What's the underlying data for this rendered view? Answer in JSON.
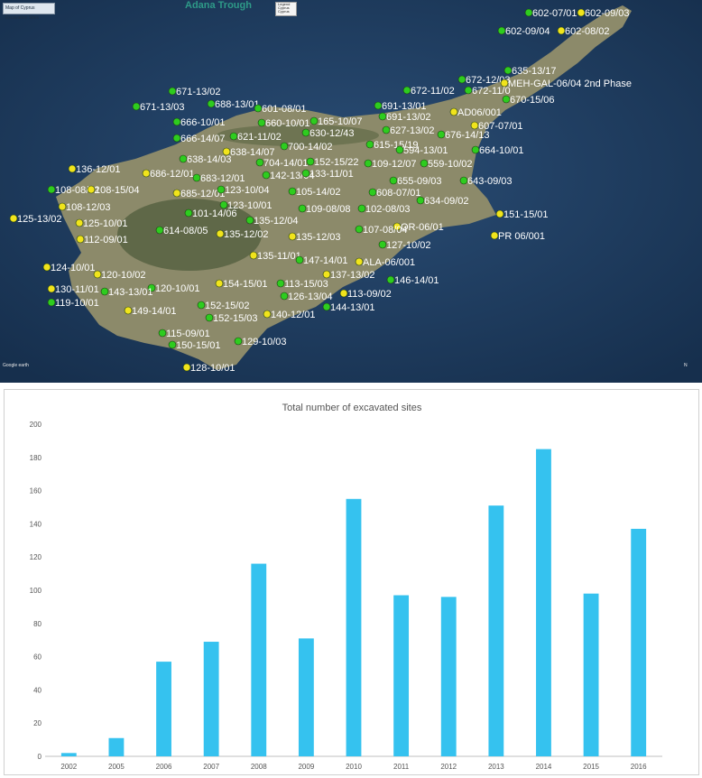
{
  "map": {
    "title_box": "Map of Cyprus Excavation Sites",
    "trough_label": "Adana Trough",
    "legend_title": "Legend",
    "legend_items": [
      "Cyprus",
      "Cyprus"
    ],
    "credit": "Google earth",
    "scale_note": "N",
    "colors": {
      "sea": "#1f3d63",
      "land": "#8c8a6a",
      "forest": "#5f6848",
      "pin_green": "#2ecc1f",
      "pin_yellow": "#f1e41c",
      "label": "#ffffff"
    },
    "sites": [
      {
        "label": "602-07/01",
        "pin": "green"
      },
      {
        "label": "602-09/03",
        "pin": "yellow"
      },
      {
        "label": "602-09/04",
        "pin": "green"
      },
      {
        "label": "602-08/02",
        "pin": "yellow"
      },
      {
        "label": "635-13/17",
        "pin": "green"
      },
      {
        "label": "672-12/03",
        "pin": "green"
      },
      {
        "label": "MEH-GAL-06/04 2nd Phase",
        "pin": "yellow"
      },
      {
        "label": "672-11/02",
        "pin": "green"
      },
      {
        "label": "672-11/0",
        "pin": "green"
      },
      {
        "label": "670-15/06",
        "pin": "green"
      },
      {
        "label": "671-13/02",
        "pin": "green"
      },
      {
        "label": "688-13/01",
        "pin": "green"
      },
      {
        "label": "671-13/03",
        "pin": "green"
      },
      {
        "label": "601-08/01",
        "pin": "green"
      },
      {
        "label": "691-13/01",
        "pin": "green"
      },
      {
        "label": "AD06/001",
        "pin": "yellow"
      },
      {
        "label": "607-07/01",
        "pin": "yellow"
      },
      {
        "label": "666-10/01",
        "pin": "green"
      },
      {
        "label": "660-10/01",
        "pin": "green"
      },
      {
        "label": "165-10/07",
        "pin": "green"
      },
      {
        "label": "691-13/02",
        "pin": "green"
      },
      {
        "label": "666-14/07",
        "pin": "green"
      },
      {
        "label": "621-11/02",
        "pin": "green"
      },
      {
        "label": "630-12/43",
        "pin": "green"
      },
      {
        "label": "627-13/02",
        "pin": "green"
      },
      {
        "label": "676-14/13",
        "pin": "green"
      },
      {
        "label": "700-14/02",
        "pin": "green"
      },
      {
        "label": "615-15/19",
        "pin": "green"
      },
      {
        "label": "594-13/01",
        "pin": "green"
      },
      {
        "label": "664-10/01",
        "pin": "green"
      },
      {
        "label": "638-14/07",
        "pin": "yellow"
      },
      {
        "label": "638-14/03",
        "pin": "green"
      },
      {
        "label": "704-14/01",
        "pin": "green"
      },
      {
        "label": "152-15/22",
        "pin": "green"
      },
      {
        "label": "109-12/07",
        "pin": "green"
      },
      {
        "label": "559-10/02",
        "pin": "green"
      },
      {
        "label": "136-12/01",
        "pin": "yellow"
      },
      {
        "label": "686-12/01",
        "pin": "yellow"
      },
      {
        "label": "683-12/01",
        "pin": "green"
      },
      {
        "label": "142-13/04",
        "pin": "green"
      },
      {
        "label": "133-11/01",
        "pin": "green"
      },
      {
        "label": "655-09/03",
        "pin": "green"
      },
      {
        "label": "643-09/03",
        "pin": "green"
      },
      {
        "label": "108-08/02",
        "pin": "green"
      },
      {
        "label": "108-15/04",
        "pin": "yellow"
      },
      {
        "label": "685-12/01",
        "pin": "yellow"
      },
      {
        "label": "123-10/04",
        "pin": "green"
      },
      {
        "label": "105-14/02",
        "pin": "green"
      },
      {
        "label": "608-07/01",
        "pin": "green"
      },
      {
        "label": "634-09/02",
        "pin": "green"
      },
      {
        "label": "123-10/01",
        "pin": "green"
      },
      {
        "label": "108-12/03",
        "pin": "yellow"
      },
      {
        "label": "101-14/06",
        "pin": "green"
      },
      {
        "label": "109-08/08",
        "pin": "green"
      },
      {
        "label": "102-08/03",
        "pin": "green"
      },
      {
        "label": "151-15/01",
        "pin": "yellow"
      },
      {
        "label": "125-13/02",
        "pin": "yellow"
      },
      {
        "label": "125-10/01",
        "pin": "yellow"
      },
      {
        "label": "135-12/04",
        "pin": "green"
      },
      {
        "label": "OR-06/01",
        "pin": "yellow"
      },
      {
        "label": "PR 06/001",
        "pin": "yellow"
      },
      {
        "label": "112-09/01",
        "pin": "yellow"
      },
      {
        "label": "614-08/05",
        "pin": "green"
      },
      {
        "label": "135-12/02",
        "pin": "yellow"
      },
      {
        "label": "135-12/03",
        "pin": "yellow"
      },
      {
        "label": "107-08/04",
        "pin": "green"
      },
      {
        "label": "127-10/02",
        "pin": "green"
      },
      {
        "label": "135-11/01",
        "pin": "yellow"
      },
      {
        "label": "124-10/01",
        "pin": "yellow"
      },
      {
        "label": "147-14/01",
        "pin": "green"
      },
      {
        "label": "ALA-06/001",
        "pin": "yellow"
      },
      {
        "label": "120-10/02",
        "pin": "yellow"
      },
      {
        "label": "137-13/02",
        "pin": "yellow"
      },
      {
        "label": "146-14/01",
        "pin": "green"
      },
      {
        "label": "130-11/01",
        "pin": "yellow"
      },
      {
        "label": "120-10/01",
        "pin": "green"
      },
      {
        "label": "154-15/01",
        "pin": "yellow"
      },
      {
        "label": "113-15/03",
        "pin": "green"
      },
      {
        "label": "113-09/02",
        "pin": "yellow"
      },
      {
        "label": "119-10/01",
        "pin": "green"
      },
      {
        "label": "143-13/01",
        "pin": "green"
      },
      {
        "label": "126-13/04",
        "pin": "green"
      },
      {
        "label": "144-13/01",
        "pin": "green"
      },
      {
        "label": "152-15/02",
        "pin": "green"
      },
      {
        "label": "149-14/01",
        "pin": "yellow"
      },
      {
        "label": "140-12/01",
        "pin": "yellow"
      },
      {
        "label": "152-15/03",
        "pin": "green"
      },
      {
        "label": "115-09/01",
        "pin": "green"
      },
      {
        "label": "129-10/03",
        "pin": "green"
      },
      {
        "label": "150-15/01",
        "pin": "green"
      },
      {
        "label": "128-10/01",
        "pin": "yellow"
      }
    ]
  },
  "chart_data": {
    "type": "bar",
    "title": "Total number of excavated sites",
    "xlabel": "",
    "ylabel": "",
    "categories": [
      "2002",
      "2005",
      "2006",
      "2007",
      "2008",
      "2009",
      "2010",
      "2011",
      "2012",
      "2013",
      "2014",
      "2015",
      "2016"
    ],
    "values": [
      2,
      11,
      57,
      69,
      116,
      71,
      155,
      97,
      96,
      151,
      185,
      98,
      137
    ],
    "ylim": [
      0,
      200
    ],
    "yticks": [
      "0",
      "20",
      "40",
      "60",
      "80",
      "100",
      "120",
      "140",
      "160",
      "180",
      "200"
    ],
    "grid": false,
    "legend": "none",
    "bar_color": "#35c2ef",
    "axis_color": "#bfbfbf"
  }
}
